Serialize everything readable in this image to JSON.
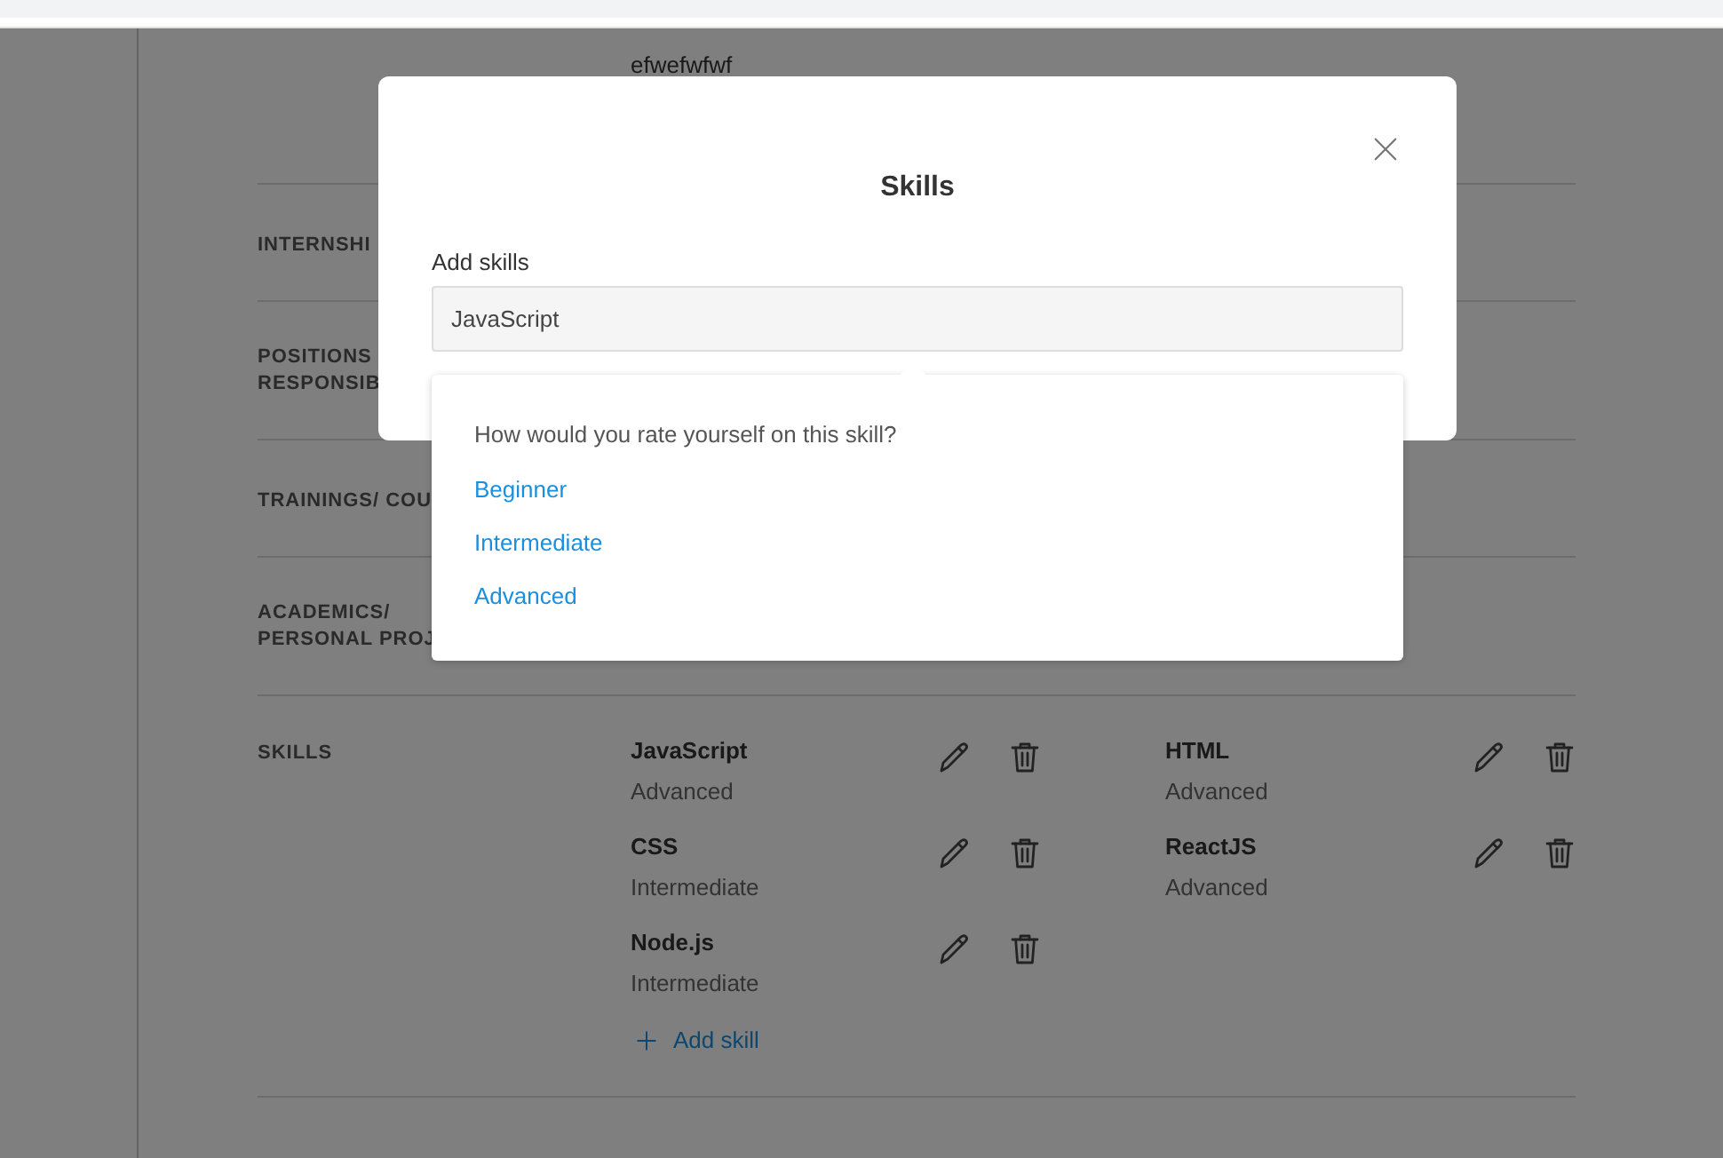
{
  "page": {
    "previous_value": "efwefwfwf",
    "sections": [
      {
        "label_lines": [
          "INTERNSHI"
        ]
      },
      {
        "label_lines": [
          "POSITIONS",
          "RESPONSIB"
        ]
      },
      {
        "label_lines": [
          "TRAININGS/ COU"
        ]
      },
      {
        "label_lines": [
          "ACADEMICS/",
          "PERSONAL PROJ"
        ]
      }
    ],
    "skills_section": {
      "label": "SKILLS",
      "skills": [
        {
          "name": "JavaScript",
          "level_text": "Advanced"
        },
        {
          "name": "HTML",
          "level_text": "Advanced"
        },
        {
          "name": "CSS",
          "level_text": "Intermediate"
        },
        {
          "name": "ReactJS",
          "level_text": "Advanced"
        },
        {
          "name": "Node.js",
          "level_text": "Intermediate"
        }
      ],
      "add_button": "Add skill"
    }
  },
  "dialog": {
    "title": "Skills",
    "field_label": "Add skills",
    "field_value": "JavaScript",
    "rating_prompt": "How would you rate yourself on this skill?",
    "rating_options": [
      {
        "label": "Beginner",
        "selected": false
      },
      {
        "label": "Intermediate",
        "selected": false
      },
      {
        "label": "Advanced",
        "selected": false
      }
    ]
  }
}
